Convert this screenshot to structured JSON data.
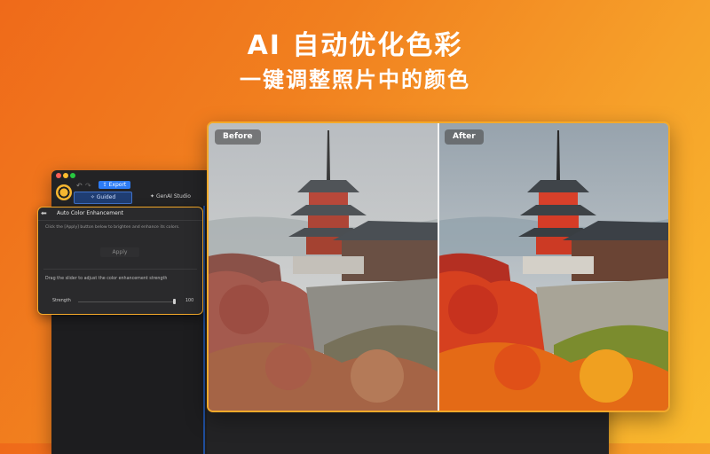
{
  "headline": {
    "title": "AI 自动优化色彩",
    "subtitle": "一键调整照片中的颜色"
  },
  "app": {
    "export_label": "Export",
    "tabs": [
      {
        "label": "Guided"
      },
      {
        "label": "GenAI Studio"
      }
    ]
  },
  "panel": {
    "title": "Auto Color Enhancement",
    "description": "Click the [Apply] button below to brighten and enhance its colors.",
    "apply_label": "Apply",
    "drag_hint": "Drag the slider to adjust the color enhancement strength",
    "strength_label": "Strength",
    "strength_value": "100",
    "strength_fraction": 1.0
  },
  "compare": {
    "before_label": "Before",
    "after_label": "After"
  },
  "colors": {
    "accent": "#f4a92a",
    "export_blue": "#2d7cf6"
  }
}
